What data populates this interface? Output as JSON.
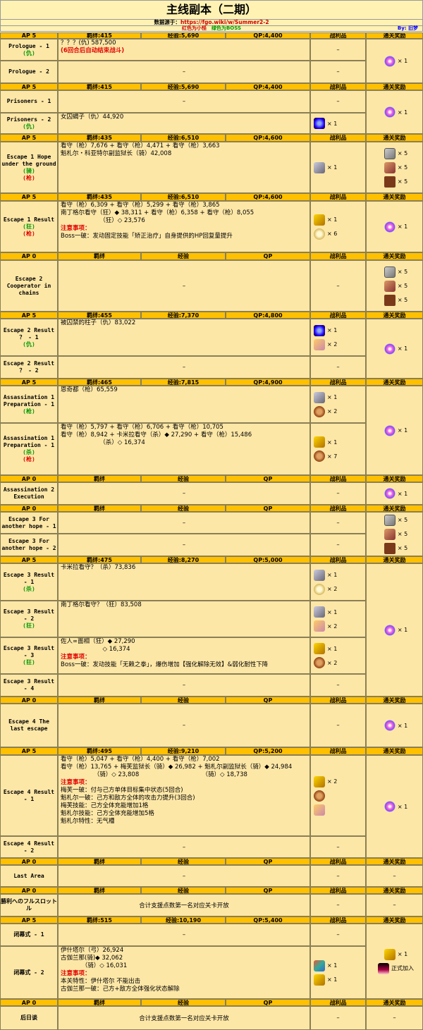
{
  "title": "主线副本（二期）",
  "source_label": "数据源于：",
  "source_url": "https://fgo.wiki/w/Summer2-2",
  "legend_red": "红色为小怪",
  "legend_green": "绿色为BOSS",
  "by": "By: 旧梦",
  "hdr": {
    "kizuna": "羁绊",
    "exp": "经验",
    "qp": "QP",
    "drop": "战利品",
    "reward": "通关奖励"
  },
  "dash": "–",
  "rows": [
    {
      "type": "h",
      "ap": "AP 5",
      "k": "羁绊:415",
      "e": "经验:5,690",
      "q": "QP:4,400"
    },
    {
      "name": "Prologue - 1",
      "tags": [
        [
          "(仇)",
          "g"
        ]
      ],
      "lines": [
        "？？？(仇) 587,500"
      ],
      "red": "(6回合后自动结束战斗)"
    },
    {
      "name": "Prologue - 2"
    },
    {
      "type": "h",
      "ap": "AP 5",
      "k": "羁绊:415",
      "e": "经验:5,690",
      "q": "QP:4,400"
    },
    {
      "name": "Prisoners - 1"
    },
    {
      "name": "Prisoners - 2",
      "tags": [
        [
          "(仇)",
          "g"
        ]
      ],
      "lines": [
        "女囚蝎子（仇）44,920"
      ],
      "drops": [
        [
          "ic-b",
          "× 1"
        ]
      ]
    },
    {
      "type": "h",
      "ap": "AP 5",
      "k": "羁绊:435",
      "e": "经验:6,510",
      "q": "QP:4,600"
    },
    {
      "name": "Escape 1 Hope under the ground",
      "tags": [
        [
          "(骑)",
          "g"
        ],
        [
          "(枪)",
          "r"
        ]
      ],
      "lines": [
        "看守（枪）7,676 + 看守（枪）4,471 + 看守（枪）3,663",
        "魁札尔・科亚特尔副监狱长（骑）42,008"
      ],
      "drops": [
        [
          "ic-g",
          "× 1"
        ]
      ]
    },
    {
      "type": "h",
      "ap": "AP 5",
      "k": "羁绊:435",
      "e": "经验:6,510",
      "q": "QP:4,600"
    },
    {
      "name": "Escape 1 Result",
      "tags": [
        [
          "(狂)",
          "g"
        ],
        [
          "(枪)",
          "r"
        ]
      ],
      "lines": [
        "看守（枪）6,309 + 看守（枪）5,299 + 看守（枪）3,865",
        "南丁格尔看守（狂）◆ 38,311 + 看守（枪）6,358 + 看守（枪）8,055",
        "　　　　　　　（狂）◇ 23,576"
      ],
      "note": "注意事项：",
      "extra": [
        "Boss一破：发动固定技能「矫正治疗」自身提供的HP回复量提升"
      ],
      "drops": [
        [
          "ic-gold",
          "× 1"
        ],
        [
          "ic-c",
          "× 6"
        ]
      ]
    },
    {
      "type": "h",
      "ap": "AP 0",
      "k": "羁绊",
      "e": "经验",
      "q": "QP"
    },
    {
      "name": "Escape 2 Cooperator in chains"
    },
    {
      "type": "h",
      "ap": "AP 5",
      "k": "羁绊:455",
      "e": "经验:7,370",
      "q": "QP:4,800"
    },
    {
      "name": "Escape 2 Result ？ - 1",
      "tags": [
        [
          "(仇)",
          "g"
        ]
      ],
      "lines": [
        "被囚禁的柱子（仇）83,022"
      ],
      "drops": [
        [
          "ic-b",
          "× 1"
        ],
        [
          "ic-p",
          "× 2"
        ]
      ]
    },
    {
      "name": "Escape 2 Result ？ - 2"
    },
    {
      "type": "h",
      "ap": "AP 5",
      "k": "羁绊:465",
      "e": "经验:7,815",
      "q": "QP:4,900"
    },
    {
      "name": "Assassination 1 Preparation - 1",
      "tags": [
        [
          "(枪)",
          "g"
        ]
      ],
      "lines": [
        "恩奇都（枪）65,559"
      ],
      "drops": [
        [
          "ic-g",
          "× 1"
        ],
        [
          "ic-m",
          "× 2"
        ]
      ]
    },
    {
      "name": "Assassination 1 Preparation - 1",
      "tags": [
        [
          "(杀)",
          "g"
        ],
        [
          "(枪)",
          "r"
        ]
      ],
      "lines": [
        "看守（枪）5,797 + 看守（枪）6,706 + 看守（枪）10,705",
        "看守（枪）8,942 + 卡米拉看守（杀）◆ 27,290 + 看守（枪）15,486",
        "　　　　　　　（杀）◇ 16,374"
      ],
      "drops": [
        [
          "ic-gold",
          "× 1"
        ],
        [
          "ic-m",
          "× 7"
        ]
      ]
    },
    {
      "type": "h",
      "ap": "AP 0",
      "k": "羁绊",
      "e": "经验",
      "q": "QP"
    },
    {
      "name": "Assassination 2 Execution"
    },
    {
      "type": "h",
      "ap": "AP 0",
      "k": "羁绊",
      "e": "经验",
      "q": "QP"
    },
    {
      "name": "Escape 3 For another hope - 1"
    },
    {
      "name": "Escape 3 For another hope - 2"
    },
    {
      "type": "h",
      "ap": "AP 5",
      "k": "羁绊:475",
      "e": "经验:8,270",
      "q": "QP:5,000"
    },
    {
      "name": "Escape 3 Result - 1",
      "tags": [
        [
          "(杀)",
          "g"
        ]
      ],
      "lines": [
        "卡米拉看守？（杀）73,836"
      ],
      "drops": [
        [
          "ic-g",
          "× 1"
        ],
        [
          "ic-c",
          "× 2"
        ]
      ]
    },
    {
      "name": "Escape 3 Result - 2",
      "tags": [
        [
          "(狂)",
          "g"
        ]
      ],
      "lines": [
        "南丁格尔看守？（狂）83,508"
      ],
      "drops": [
        [
          "ic-g",
          "× 1"
        ],
        [
          "ic-p",
          "× 2"
        ]
      ]
    },
    {
      "name": "Escape 3 Result - 3",
      "tags": [
        [
          "(狂)",
          "g"
        ]
      ],
      "lines": [
        "佐人∞面相（狂）◆ 27,290",
        "　　　　　　　◇ 16,374"
      ],
      "note": "注意事项：",
      "extra": [
        "Boss一破：发动技能「无赖之拳」，爆伤增加【强化解除无效】&弱化耐性下降"
      ],
      "drops": [
        [
          "ic-gold",
          "× 1"
        ],
        [
          "ic-m",
          "× 2"
        ]
      ]
    },
    {
      "name": "Escape 3 Result - 4"
    },
    {
      "type": "h",
      "ap": "AP 0",
      "k": "羁绊",
      "e": "经验",
      "q": "QP"
    },
    {
      "name": "Escape 4 The last escape"
    },
    {
      "type": "h",
      "ap": "AP 5",
      "k": "羁绊:495",
      "e": "经验:9,210",
      "q": "QP:5,200"
    },
    {
      "name": "Escape 4 Result - 1",
      "lines": [
        "看守（枪）5,047 + 看守（枪）4,400 + 看守（枪）7,002",
        "看守（枪）13,765 + 梅芙监狱长（骑）◆ 26,982 + 魁札尔副监狱长（骑）◆ 24,984",
        "　　　　　　（骑）◇ 23,808　　　　　　　　　　　（骑）◇ 18,738"
      ],
      "note": "注意事项：",
      "extra": [
        "梅芙一破：付与己方单体目标集中状态(5回合)",
        "魁札尔一破：己方和敌方全体的攻击力提升(3回合)",
        "梅芙技能：己方全体充能增加1格",
        "魁札尔技能：己方全体充能增加5格",
        "魁札尔特性：无气槽"
      ],
      "drops": [
        [
          "ic-gold",
          "× 2"
        ],
        [
          "ic-m",
          ""
        ],
        [
          "ic-p",
          ""
        ]
      ]
    },
    {
      "name": "Escape 4 Result - 2"
    },
    {
      "type": "h",
      "ap": "AP 0",
      "k": "羁绊",
      "e": "经验",
      "q": "QP"
    },
    {
      "name": "Last Area",
      "rdash": true
    },
    {
      "type": "h",
      "ap": "AP 0",
      "k": "羁绊",
      "e": "经验",
      "q": "QP"
    },
    {
      "name": "勝利へのフルスロットル",
      "center": "合计支援点数第一名对应关卡开放",
      "rdash": true
    },
    {
      "type": "h",
      "ap": "AP 5",
      "k": "羁绊:515",
      "e": "经验:10,190",
      "q": "QP:5,400"
    },
    {
      "name": "闭幕式 - 1"
    },
    {
      "name": "闭幕式 - 2",
      "lines": [
        "伊什塔尔（弓）26,924",
        "古伽兰那(骑)◆ 32,062",
        "　　　　（骑）◇ 16,031"
      ],
      "note": "注意事项：",
      "extra": [
        "本关特性：伊什塔尔 不能出击",
        "古伽兰那一破：己方+敌方全体强化状态解除"
      ],
      "drops": [
        [
          "ic-mix",
          "× 1"
        ],
        [
          "ic-gold",
          "× 1"
        ]
      ]
    },
    {
      "type": "h",
      "ap": "AP 0",
      "k": "羁绊",
      "e": "经验",
      "q": "QP"
    },
    {
      "name": "后日谈",
      "center": "合计支援点数第一名对应关卡开放",
      "rdash": true
    }
  ],
  "rewards": [
    {
      "items": [
        [
          "ic-q",
          "× 1"
        ]
      ]
    },
    {
      "items": [
        [
          "ic-q",
          "× 1"
        ]
      ]
    },
    {
      "items": [
        [
          "ic-w",
          "× 5"
        ],
        [
          "ic-h",
          "× 5"
        ],
        [
          "ic-s",
          "× 5"
        ]
      ]
    },
    {
      "items": [
        [
          "ic-q",
          "× 1"
        ]
      ]
    },
    {
      "items": [
        [
          "ic-w",
          "× 5"
        ],
        [
          "ic-h",
          "× 5"
        ],
        [
          "ic-s",
          "× 5"
        ]
      ]
    },
    {
      "items": [
        [
          "ic-q",
          "× 1"
        ]
      ]
    },
    {
      "items": [
        [
          "ic-q",
          "× 1"
        ]
      ]
    },
    {
      "items": [
        [
          "ic-q",
          "× 1"
        ]
      ]
    },
    {
      "items": [
        [
          "ic-w",
          "× 5"
        ],
        [
          "ic-h",
          "× 5"
        ],
        [
          "ic-s",
          "× 5"
        ]
      ]
    },
    {
      "items": [
        [
          "ic-q",
          "× 1"
        ]
      ]
    },
    {
      "items": [
        [
          "ic-q",
          "× 1"
        ]
      ]
    },
    {
      "items": [
        [
          "ic-q",
          "× 1"
        ]
      ]
    },
    {
      "items": [
        [
          "ic-gold",
          "× 1"
        ],
        [
          "ic-avatar",
          "正式加入"
        ]
      ]
    }
  ]
}
